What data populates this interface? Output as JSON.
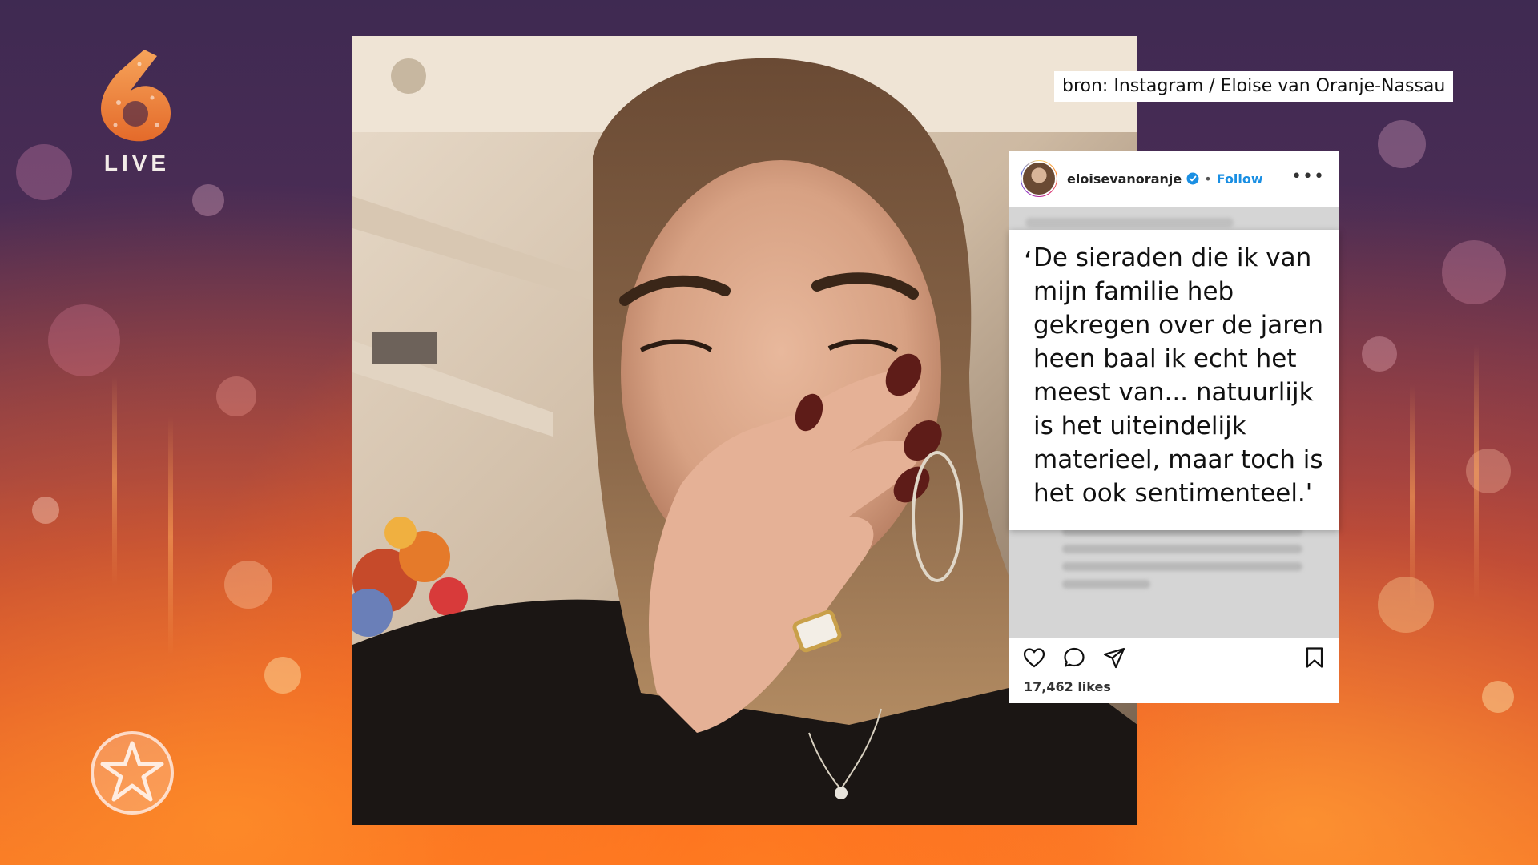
{
  "channel_logo": {
    "number": "6",
    "label": "LIVE"
  },
  "source_caption": "bron: Instagram / Eloise van Oranje-Nassau",
  "instagram_post": {
    "username": "eloisevanoranje",
    "separator": "•",
    "follow_label": "Follow",
    "more_icon": "more-horizontal-icon",
    "likes": "17,462 likes",
    "action_icons": [
      "heart-icon",
      "comment-icon",
      "share-icon",
      "bookmark-icon"
    ]
  },
  "quote": {
    "open_mark": "‘",
    "text": "De sieraden die ik van mijn familie heb gekregen over de jaren heen baal ik echt het meest van... natuurlijk is het uiteindelijk materieel, maar toch is het ook sentimenteel.'"
  },
  "colors": {
    "follow_blue": "#1a8fe3",
    "logo_orange": "#f08a3c"
  }
}
